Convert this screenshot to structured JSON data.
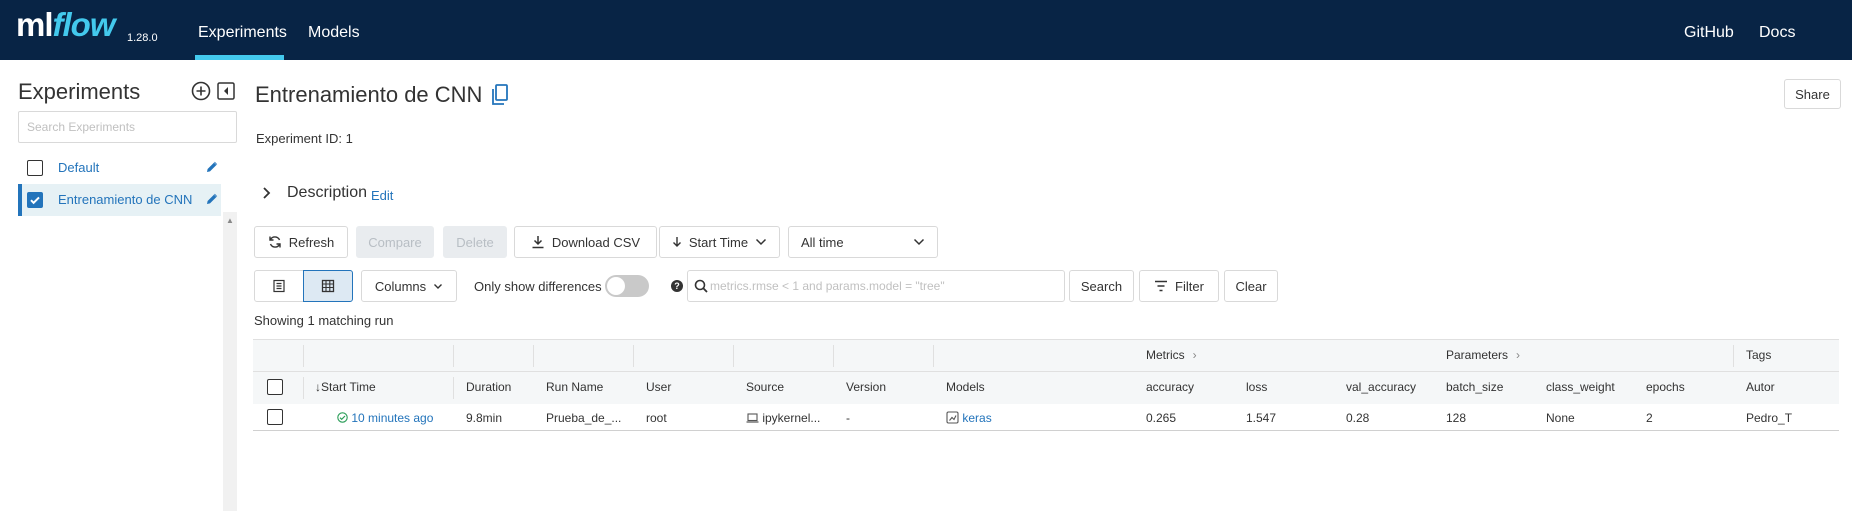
{
  "header": {
    "logo_ml": "ml",
    "logo_flow": "flow",
    "version": "1.28.0",
    "nav": {
      "experiments": "Experiments",
      "models": "Models",
      "github": "GitHub",
      "docs": "Docs"
    }
  },
  "sidebar": {
    "title": "Experiments",
    "search_placeholder": "Search Experiments",
    "items": [
      {
        "label": "Default",
        "checked": false
      },
      {
        "label": "Entrenamiento de CNN",
        "checked": true
      }
    ]
  },
  "experiment": {
    "title": "Entrenamiento de CNN",
    "share_label": "Share",
    "id_label": "Experiment ID:",
    "id_value": "1",
    "description_label": "Description",
    "description_edit": "Edit"
  },
  "toolbar": {
    "refresh": "Refresh",
    "compare": "Compare",
    "delete": "Delete",
    "download_csv": "Download CSV",
    "sort_label": "Start Time",
    "time_filter": "All time",
    "columns": "Columns",
    "only_diff": "Only show differences",
    "search_placeholder": "metrics.rmse < 1 and params.model = \"tree\"",
    "search_button": "Search",
    "filter_button": "Filter",
    "clear_button": "Clear",
    "showing": "Showing 1 matching run"
  },
  "table": {
    "groups": {
      "metrics": "Metrics",
      "parameters": "Parameters",
      "tags": "Tags"
    },
    "columns": {
      "start_time": "Start Time",
      "duration": "Duration",
      "run_name": "Run Name",
      "user": "User",
      "source": "Source",
      "version": "Version",
      "models": "Models",
      "accuracy": "accuracy",
      "loss": "loss",
      "val_accuracy": "val_accuracy",
      "batch_size": "batch_size",
      "class_weight": "class_weight",
      "epochs": "epochs",
      "autor": "Autor"
    },
    "rows": [
      {
        "start_time": "10 minutes ago",
        "duration": "9.8min",
        "run_name": "Prueba_de_...",
        "user": "root",
        "source": "ipykernel...",
        "version": "-",
        "models": "keras",
        "accuracy": "0.265",
        "loss": "1.547",
        "val_accuracy": "0.28",
        "batch_size": "128",
        "class_weight": "None",
        "epochs": "2",
        "autor": "Pedro_T"
      }
    ]
  },
  "colors": {
    "header_bg": "#082445",
    "accent": "#43c9ed",
    "link": "#2374bb"
  }
}
